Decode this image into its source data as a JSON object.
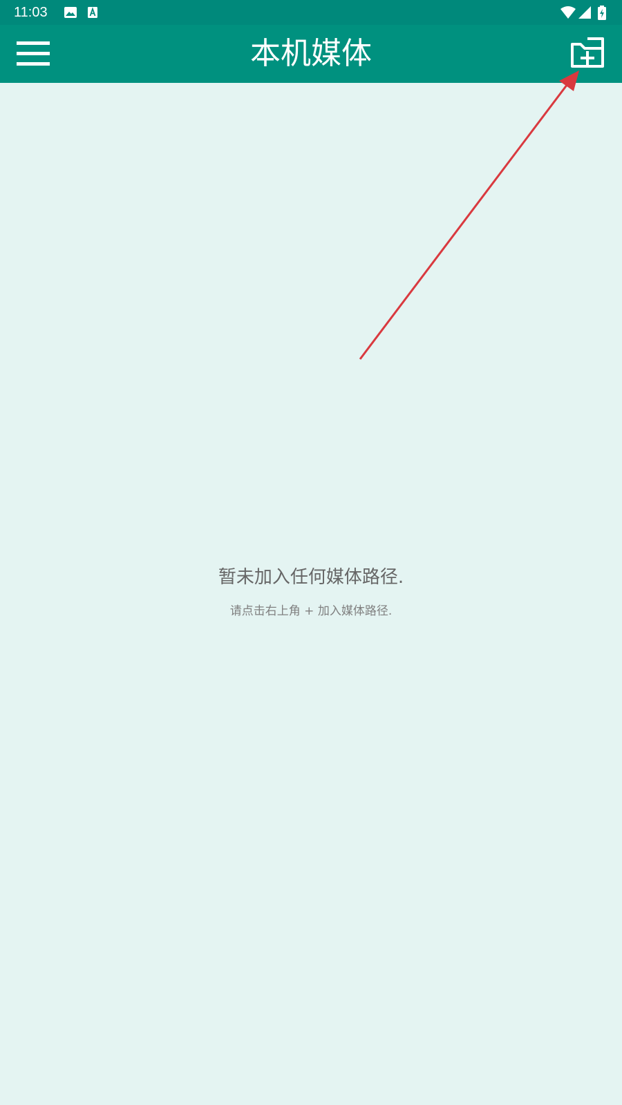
{
  "status_bar": {
    "time": "11:03",
    "left_icons": [
      "image-icon",
      "text-a-icon"
    ],
    "right_icons": [
      "wifi-icon",
      "cellular-signal-icon",
      "battery-charging-icon"
    ]
  },
  "app_bar": {
    "title": "本机媒体",
    "left_icon": "hamburger-menu-icon",
    "right_icon": "folder-add-icon"
  },
  "empty_state": {
    "title": "暂未加入任何媒体路径.",
    "hint": "请点击右上角 + 加入媒体路径."
  },
  "colors": {
    "status_bar": "#00897b",
    "app_bar": "#00917f",
    "background": "#e4f4f2",
    "arrow": "#d9393f",
    "text_primary": "#666666",
    "text_secondary": "#808080"
  }
}
